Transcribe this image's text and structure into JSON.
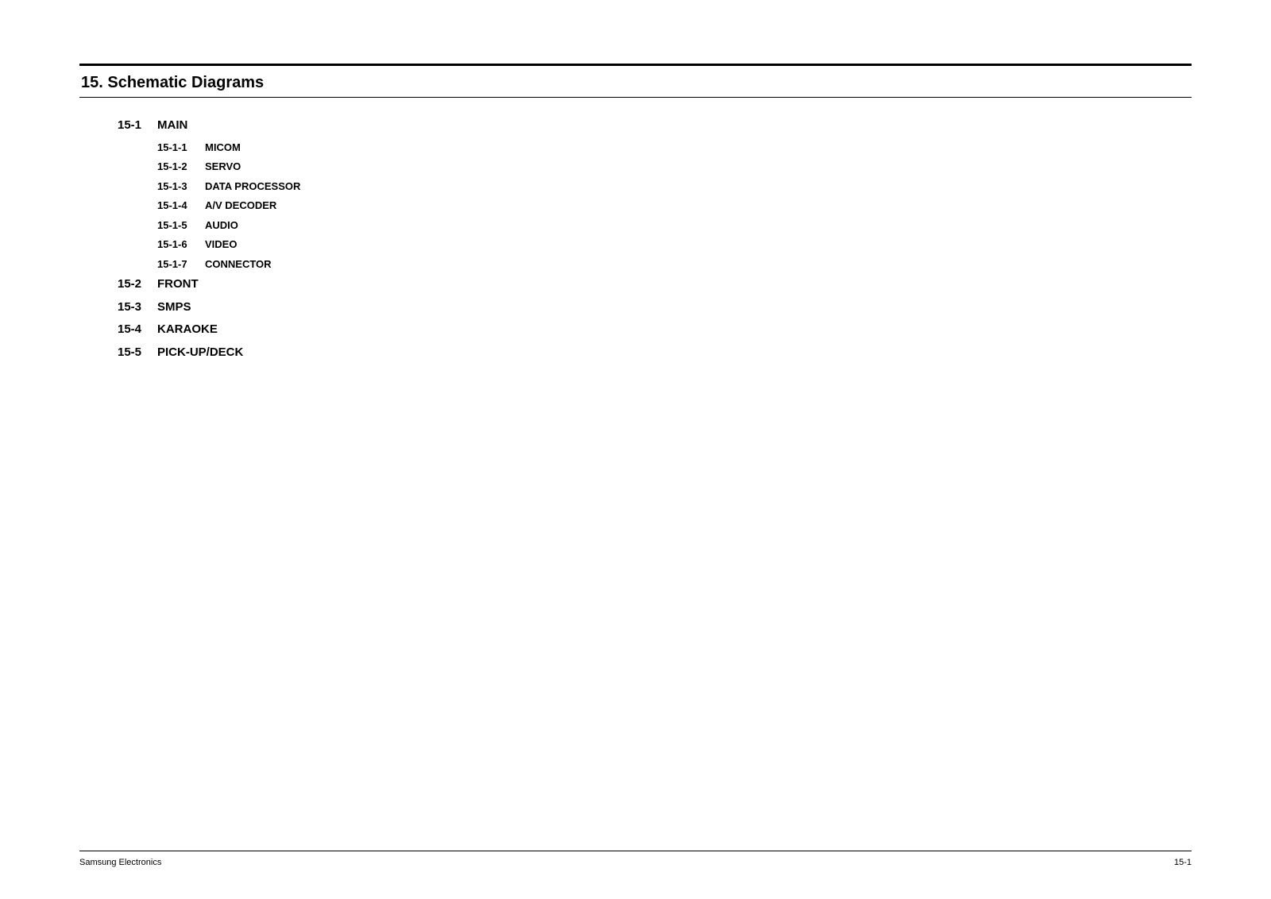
{
  "chapter": {
    "number": "15.",
    "title": "Schematic Diagrams"
  },
  "sections": [
    {
      "num": "15-1",
      "title": "MAIN",
      "subs": [
        {
          "num": "15-1-1",
          "title": "MICOM"
        },
        {
          "num": "15-1-2",
          "title": "SERVO"
        },
        {
          "num": "15-1-3",
          "title": "DATA PROCESSOR"
        },
        {
          "num": "15-1-4",
          "title": "A/V DECODER"
        },
        {
          "num": "15-1-5",
          "title": "AUDIO"
        },
        {
          "num": "15-1-6",
          "title": "VIDEO"
        },
        {
          "num": "15-1-7",
          "title": "CONNECTOR"
        }
      ]
    },
    {
      "num": "15-2",
      "title": "FRONT",
      "subs": []
    },
    {
      "num": "15-3",
      "title": "SMPS",
      "subs": []
    },
    {
      "num": "15-4",
      "title": "KARAOKE",
      "subs": []
    },
    {
      "num": "15-5",
      "title": "PICK-UP/DECK",
      "subs": []
    }
  ],
  "footer": {
    "left": "Samsung Electronics",
    "right": "15-1"
  }
}
